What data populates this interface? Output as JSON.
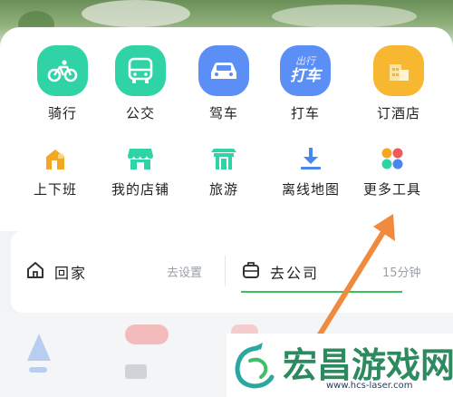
{
  "row1": [
    {
      "label": "骑行",
      "icon": "bike-icon",
      "color": "#2fd3a5"
    },
    {
      "label": "公交",
      "icon": "bus-icon",
      "color": "#2fd3a5"
    },
    {
      "label": "驾车",
      "icon": "car-icon",
      "color": "#5b8ff5"
    },
    {
      "label": "打车",
      "icon": "taxi-icon",
      "color": "#5b8ff5",
      "icon_text_top": "出行",
      "icon_text": "打车"
    },
    {
      "label": "订酒店",
      "icon": "hotel-icon",
      "color": "#f7b731"
    }
  ],
  "row2": [
    {
      "label": "上下班",
      "icon": "commute-home-icon",
      "color": "#f5a623"
    },
    {
      "label": "我的店铺",
      "icon": "shop-icon",
      "color": "#2fd3a5"
    },
    {
      "label": "旅游",
      "icon": "travel-gate-icon",
      "color": "#2fd3a5"
    },
    {
      "label": "离线地图",
      "icon": "download-icon",
      "color": "#4a86f0"
    },
    {
      "label": "更多工具",
      "icon": "more-tools-icon",
      "color": "#f5a623"
    }
  ],
  "destinations": {
    "home": {
      "label": "回家",
      "hint": "去设置",
      "icon": "home-icon"
    },
    "company": {
      "label": "去公司",
      "hint": "15分钟",
      "icon": "briefcase-icon"
    }
  },
  "watermark": {
    "title": "宏昌游戏网",
    "url": "www.hcs-laser.com"
  },
  "colors": {
    "accent_orange": "#f08a3c",
    "progress_green": "#3dbf5a"
  }
}
